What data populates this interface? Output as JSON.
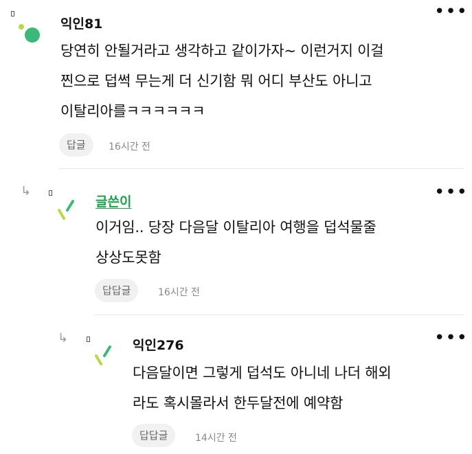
{
  "comments": [
    {
      "nickname": "익인81",
      "lines": [
        "당연히 안될거라고 생각하고 같이가자~ 이런거지 이걸",
        "찐으로 덥썩 무는게 더 신기함 뭐 어디 부산도 아니고",
        "이탈리아를ㅋㅋㅋㅋㅋㅋ"
      ],
      "reply_label": "답글",
      "time": "16시간 전",
      "more_label": "•••"
    },
    {
      "nickname": "글쓴이",
      "lines": [
        "이거임.. 당장 다음달 이탈리아 여행을 덥석물줄",
        "상상도못함"
      ],
      "reply_label": "답답글",
      "time": "16시간 전",
      "more_label": "•••"
    },
    {
      "nickname": "익인276",
      "lines": [
        "다음달이면 그렇게 덥석도 아니네 나더 해외",
        "라도 혹시몰라서 한두달전에 예약함"
      ],
      "reply_label": "답답글",
      "time": "14시간 전",
      "more_label": "•••"
    }
  ],
  "colors": {
    "author": "#1aa34a",
    "avatar_green": "#3cb878",
    "avatar_lime": "#b6d94c"
  }
}
